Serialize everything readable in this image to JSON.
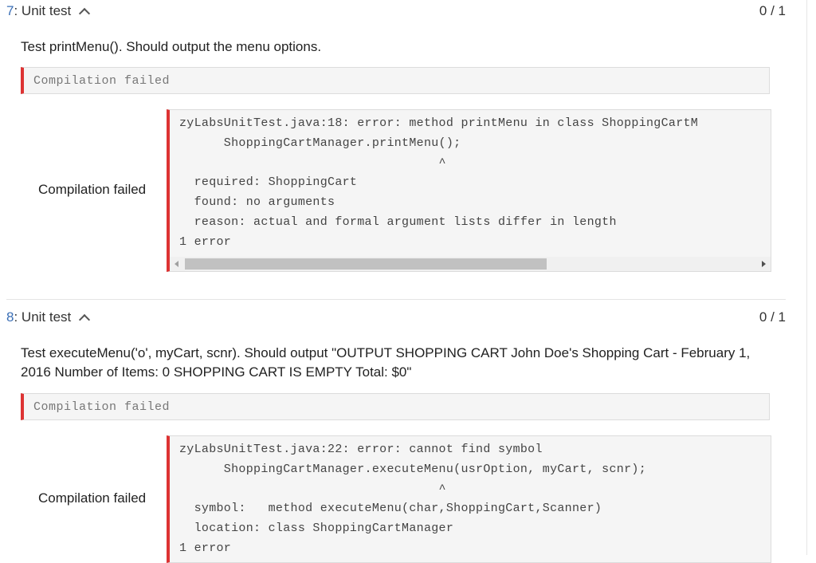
{
  "tests": [
    {
      "number": "7",
      "title": ": Unit test",
      "score": "0 / 1",
      "description": "Test printMenu(). Should output the menu options.",
      "status": "Compilation failed",
      "result_label": "Compilation failed",
      "output": "zyLabsUnitTest.java:18: error: method printMenu in class ShoppingCartM\n      ShoppingCartManager.printMenu();\n                                   ^\n  required: ShoppingCart\n  found: no arguments\n  reason: actual and formal argument lists differ in length\n1 error"
    },
    {
      "number": "8",
      "title": ": Unit test",
      "score": "0 / 1",
      "description": "Test executeMenu('o', myCart, scnr). Should output \"OUTPUT SHOPPING CART John Doe's Shopping Cart - February 1, 2016 Number of Items: 0 SHOPPING CART IS EMPTY Total: $0\"",
      "status": "Compilation failed",
      "result_label": "Compilation failed",
      "output": "zyLabsUnitTest.java:22: error: cannot find symbol\n      ShoppingCartManager.executeMenu(usrOption, myCart, scnr);\n                                   ^\n  symbol:   method executeMenu(char,ShoppingCart,Scanner)\n  location: class ShoppingCartManager\n1 error"
    }
  ],
  "colors": {
    "error_accent": "#d33333",
    "link_blue": "#3b6fb6"
  },
  "icons": {
    "collapse": "chevron-up-icon"
  }
}
